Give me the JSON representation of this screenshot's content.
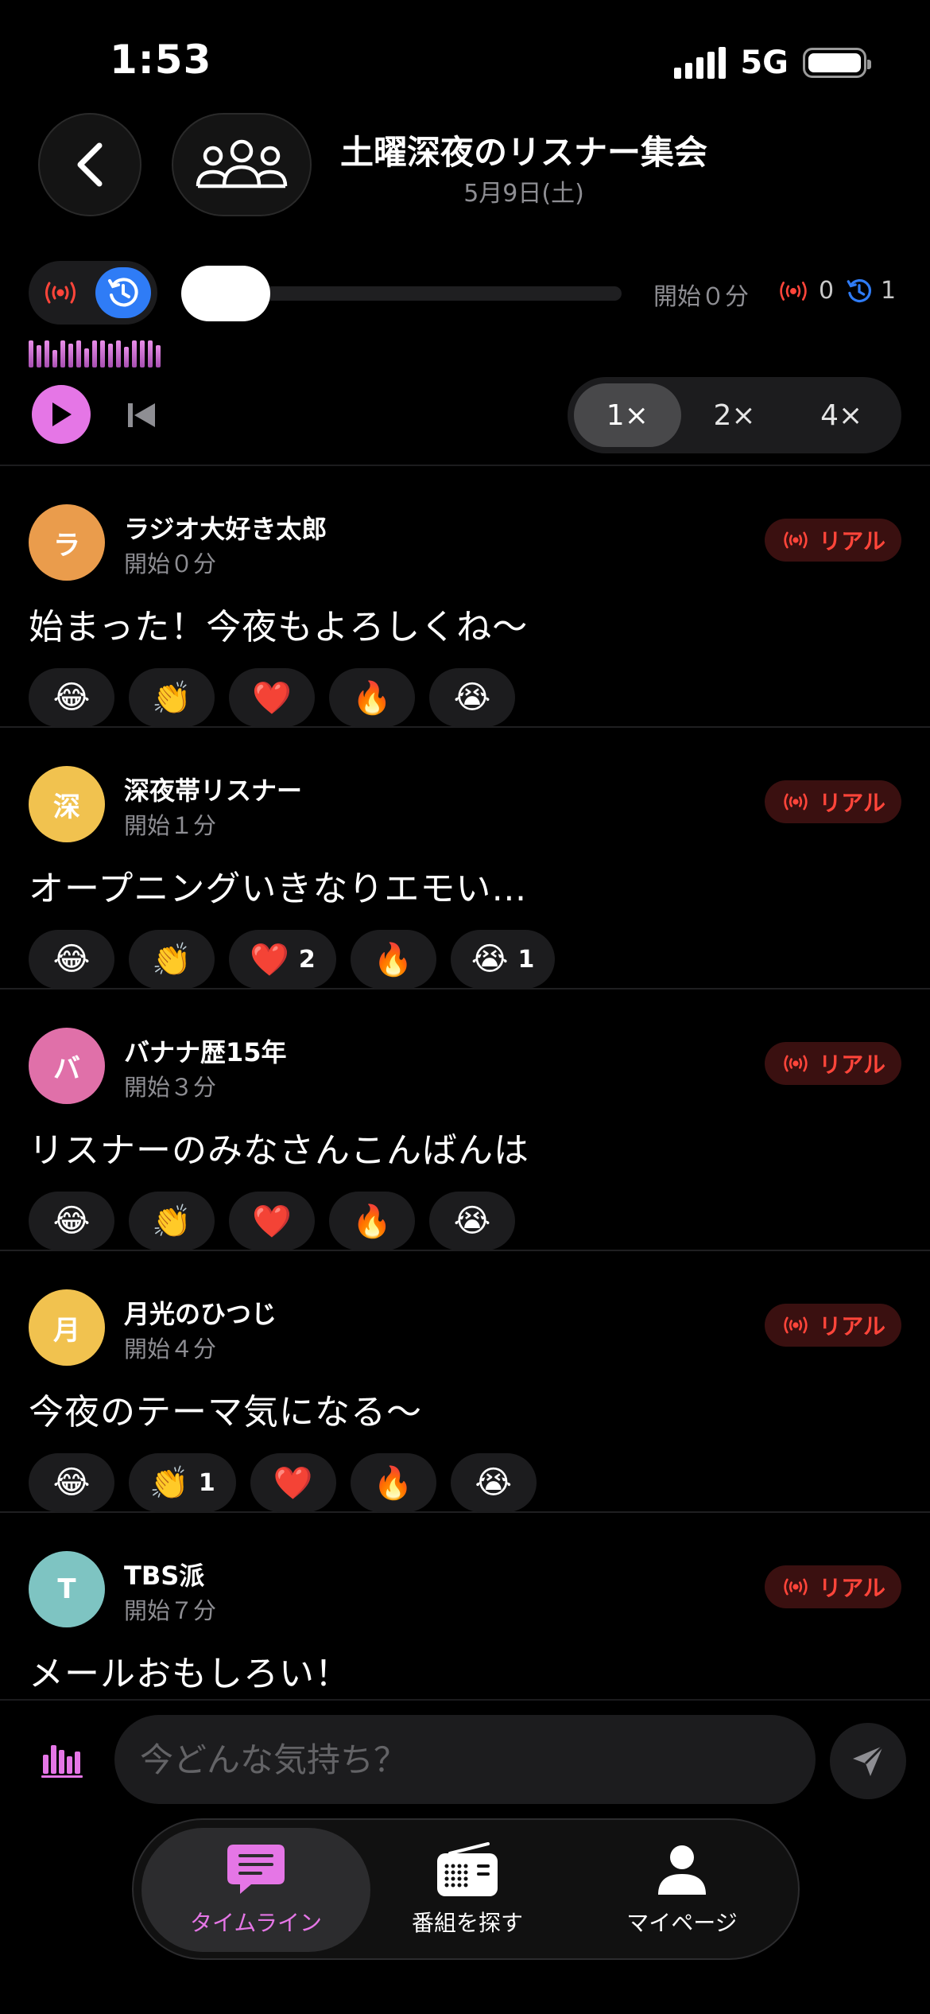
{
  "status": {
    "time": "1:53",
    "network": "5G"
  },
  "header": {
    "title": "土曜深夜のリスナー集会",
    "date": "5月9日(土)"
  },
  "player": {
    "progress_label": "開始０分",
    "progress_fraction": 0.0,
    "live_count": "0",
    "replay_count": "1",
    "speeds": [
      "1×",
      "2×",
      "4×"
    ],
    "selected_speed": "1×"
  },
  "posts": [
    {
      "initial": "ラ",
      "avatar_color": "#ea9c4c",
      "author": "ラジオ大好き太郎",
      "time": "開始０分",
      "badge": "リアル",
      "text": "始まった！今夜もよろしくね〜",
      "reactions": [
        {
          "emoji": "😂",
          "count": ""
        },
        {
          "emoji": "👏",
          "count": ""
        },
        {
          "emoji": "❤️",
          "count": ""
        },
        {
          "emoji": "🔥",
          "count": ""
        },
        {
          "emoji": "😭",
          "count": ""
        }
      ]
    },
    {
      "initial": "深",
      "avatar_color": "#f1c24f",
      "author": "深夜帯リスナー",
      "time": "開始１分",
      "badge": "リアル",
      "text": "オープニングいきなりエモい…",
      "reactions": [
        {
          "emoji": "😂",
          "count": ""
        },
        {
          "emoji": "👏",
          "count": ""
        },
        {
          "emoji": "❤️",
          "count": "2"
        },
        {
          "emoji": "🔥",
          "count": ""
        },
        {
          "emoji": "😭",
          "count": "1"
        }
      ]
    },
    {
      "initial": "バ",
      "avatar_color": "#e070a9",
      "author": "バナナ歴15年",
      "time": "開始３分",
      "badge": "リアル",
      "text": "リスナーのみなさんこんばんは",
      "reactions": [
        {
          "emoji": "😂",
          "count": ""
        },
        {
          "emoji": "👏",
          "count": ""
        },
        {
          "emoji": "❤️",
          "count": ""
        },
        {
          "emoji": "🔥",
          "count": ""
        },
        {
          "emoji": "😭",
          "count": ""
        }
      ]
    },
    {
      "initial": "月",
      "avatar_color": "#f1c24f",
      "author": "月光のひつじ",
      "time": "開始４分",
      "badge": "リアル",
      "text": "今夜のテーマ気になる〜",
      "reactions": [
        {
          "emoji": "😂",
          "count": ""
        },
        {
          "emoji": "👏",
          "count": "1"
        },
        {
          "emoji": "❤️",
          "count": ""
        },
        {
          "emoji": "🔥",
          "count": ""
        },
        {
          "emoji": "😭",
          "count": ""
        }
      ]
    },
    {
      "initial": "T",
      "avatar_color": "#7ec4c2",
      "author": "TBS派",
      "time": "開始７分",
      "badge": "リアル",
      "text": "メールおもしろい！",
      "reactions": []
    }
  ],
  "composer": {
    "placeholder": "今どんな気持ち？"
  },
  "tabs": [
    {
      "label": "タイムライン",
      "icon": "chat-bubble-icon",
      "active": true
    },
    {
      "label": "番組を探す",
      "icon": "radio-icon",
      "active": false
    },
    {
      "label": "マイページ",
      "icon": "person-icon",
      "active": false
    }
  ],
  "colors": {
    "accent": "#e576e6",
    "live_red": "#ff453a",
    "replay_blue": "#2f7cf6"
  }
}
